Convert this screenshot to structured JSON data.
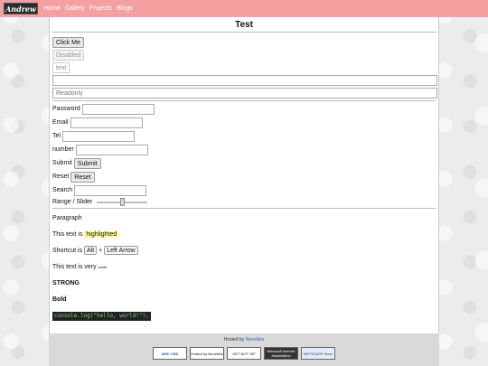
{
  "nav": {
    "logo": "Andrew",
    "links": [
      "Home",
      "Gallery",
      "Projects",
      "Blogs"
    ]
  },
  "page": {
    "title": "Test",
    "click_me": "Click Me",
    "disabled": "Disabled",
    "text_button": "text",
    "readonly_placeholder": "Readonly",
    "password_label": "Password",
    "email_label": "Email",
    "tel_label": "Tel",
    "number_label": "number",
    "submit_label": "Submit",
    "submit_button": "Submit",
    "reset_label": "Reset",
    "reset_button": "Reset",
    "search_label": "Search",
    "range_label": "Range / Slider",
    "slider_value": 0.5,
    "paragraph": "Paragraph",
    "highlight_prefix": "This text is",
    "highlight_word": "highlighted",
    "shortcut_prefix": "Shortcut is",
    "key_alt": "Alt",
    "plus": "+",
    "key_left": "Left Arrow",
    "small_prefix": "This text is very",
    "small_word": "small",
    "strong": "STRONG",
    "bold": "Bold",
    "code": "console.log(\"hello, world!\");"
  },
  "footer": {
    "hosted_by": "Hosted by",
    "host_name": "Neocities",
    "badges": [
      "W3C CSS",
      "Hosted by Neocities",
      "GET NOT GIF",
      "Microsoft Internet Assimilation",
      "NETSCAPE Now!"
    ]
  }
}
